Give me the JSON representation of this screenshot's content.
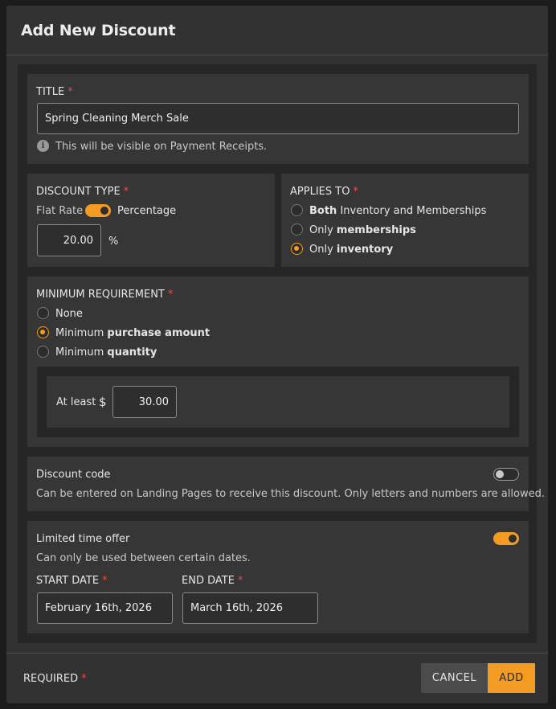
{
  "modal": {
    "title": "Add New Discount"
  },
  "title_section": {
    "label": "TITLE",
    "required_mark": "*",
    "value": "Spring Cleaning Merch Sale",
    "hint": "This will be visible on Payment Receipts."
  },
  "discount_type": {
    "label": "DISCOUNT TYPE",
    "required_mark": "*",
    "left_option": "Flat Rate",
    "right_option": "Percentage",
    "toggle_on": true,
    "amount": "20.00",
    "unit": "%"
  },
  "applies_to": {
    "label": "APPLIES TO",
    "required_mark": "*",
    "options": [
      {
        "bold": "Both",
        "rest": " Inventory and Memberships",
        "selected": false
      },
      {
        "pre": "Only ",
        "bold": "memberships",
        "selected": false
      },
      {
        "pre": "Only ",
        "bold": "inventory",
        "selected": true
      }
    ]
  },
  "minimum_requirement": {
    "label": "MINIMUM REQUIREMENT",
    "required_mark": "*",
    "options": [
      {
        "text": "None",
        "selected": false
      },
      {
        "pre": "Minimum ",
        "bold": "purchase amount",
        "selected": true
      },
      {
        "pre": "Minimum ",
        "bold": "quantity",
        "selected": false
      }
    ],
    "at_least_label": "At least",
    "currency": "$",
    "amount": "30.00"
  },
  "discount_code": {
    "label": "Discount code",
    "description": "Can be entered on Landing Pages to receive this discount. Only letters and numbers are allowed.",
    "enabled": false
  },
  "limited_time": {
    "label": "Limited time offer",
    "description": "Can only be used between certain dates.",
    "enabled": true,
    "start_label": "START DATE",
    "start_value": "February 16th, 2026",
    "end_label": "END DATE",
    "end_value": "March 16th, 2026",
    "required_mark": "*"
  },
  "footer": {
    "required_label": "REQUIRED",
    "required_mark": "*",
    "cancel_label": "CANCEL",
    "add_label": "ADD"
  },
  "colors": {
    "accent": "#f39b22",
    "required": "#e84a4a",
    "background": "#323232"
  }
}
